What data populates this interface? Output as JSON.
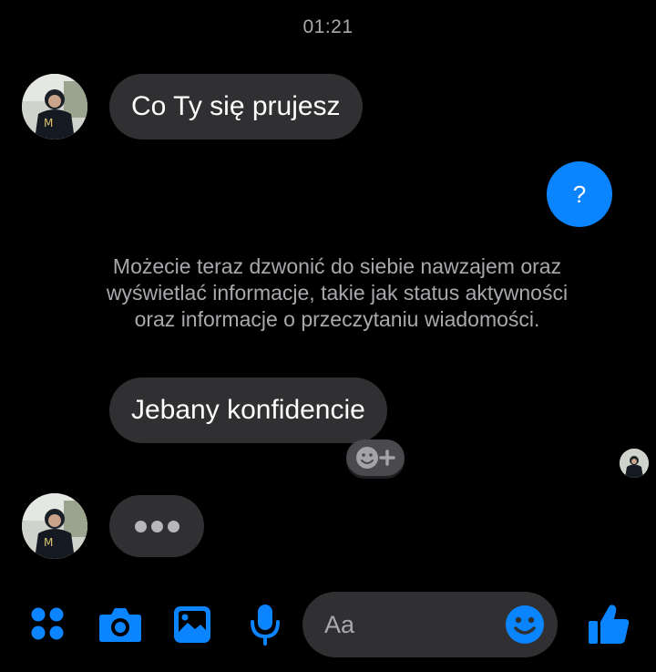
{
  "status": {
    "time": "01:21"
  },
  "messages": {
    "incoming_1": "Co Ty się prujesz",
    "outgoing_1": "?",
    "notice": "Możecie teraz dzwonić do siebie nawzajem oraz wyświetlać informacje, takie jak status aktywności oraz informacje o przeczytaniu wiadomości.",
    "incoming_2": "Jebany konfidencie"
  },
  "composer": {
    "placeholder": "Aa",
    "icons": [
      "menu-icon",
      "camera-icon",
      "image-icon",
      "microphone-icon",
      "emoji-icon",
      "thumbs-up-icon"
    ]
  },
  "colors": {
    "accent": "#0a84ff",
    "bubble_incoming": "#303033",
    "bubble_outgoing": "#0a84ff",
    "background": "#000000",
    "meta_text": "#a8a8ad"
  }
}
